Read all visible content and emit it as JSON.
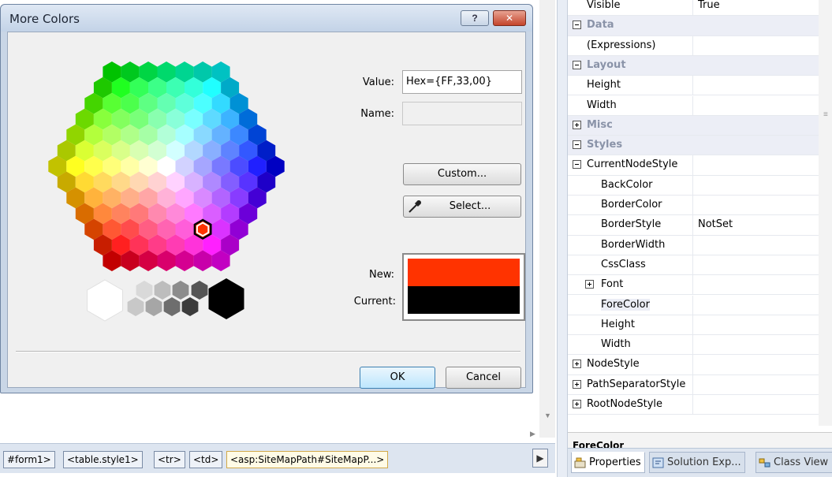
{
  "dialog": {
    "title": "More Colors",
    "help_symbol": "?",
    "close_symbol": "✕",
    "value_label": "Value:",
    "value": "Hex={FF,33,00}",
    "name_label": "Name:",
    "name_value": "",
    "custom_button": "Custom...",
    "select_button": "Select...",
    "new_label": "New:",
    "current_label": "Current:",
    "new_color": "#ff3300",
    "current_color": "#000000",
    "ok_button": "OK",
    "cancel_button": "Cancel"
  },
  "tag_bar": {
    "items": [
      "#form1>",
      "<table.style1>",
      "<tr>",
      "<td>",
      "<asp:SiteMapPath#SiteMapP...>"
    ],
    "nav_symbol": "▶"
  },
  "properties": {
    "rows": [
      {
        "name": "Visible",
        "value": "True"
      },
      {
        "name": "Data",
        "value": ""
      },
      {
        "name": "(Expressions)",
        "value": ""
      },
      {
        "name": "Layout",
        "value": ""
      },
      {
        "name": "Height",
        "value": ""
      },
      {
        "name": "Width",
        "value": ""
      },
      {
        "name": "Misc",
        "value": ""
      },
      {
        "name": "Styles",
        "value": ""
      },
      {
        "name": "CurrentNodeStyle",
        "value": ""
      },
      {
        "name": "BackColor",
        "value": ""
      },
      {
        "name": "BorderColor",
        "value": ""
      },
      {
        "name": "BorderStyle",
        "value": "NotSet"
      },
      {
        "name": "BorderWidth",
        "value": ""
      },
      {
        "name": "CssClass",
        "value": ""
      },
      {
        "name": "Font",
        "value": ""
      },
      {
        "name": "ForeColor",
        "value": ""
      },
      {
        "name": "Height",
        "value": ""
      },
      {
        "name": "Width",
        "value": ""
      },
      {
        "name": "NodeStyle",
        "value": ""
      },
      {
        "name": "PathSeparatorStyle",
        "value": ""
      },
      {
        "name": "RootNodeStyle",
        "value": ""
      }
    ],
    "description_title": "ForeColor",
    "grip_symbol": "≡"
  },
  "bottom_tabs": [
    "Properties",
    "Solution Exp...",
    "Class View"
  ]
}
